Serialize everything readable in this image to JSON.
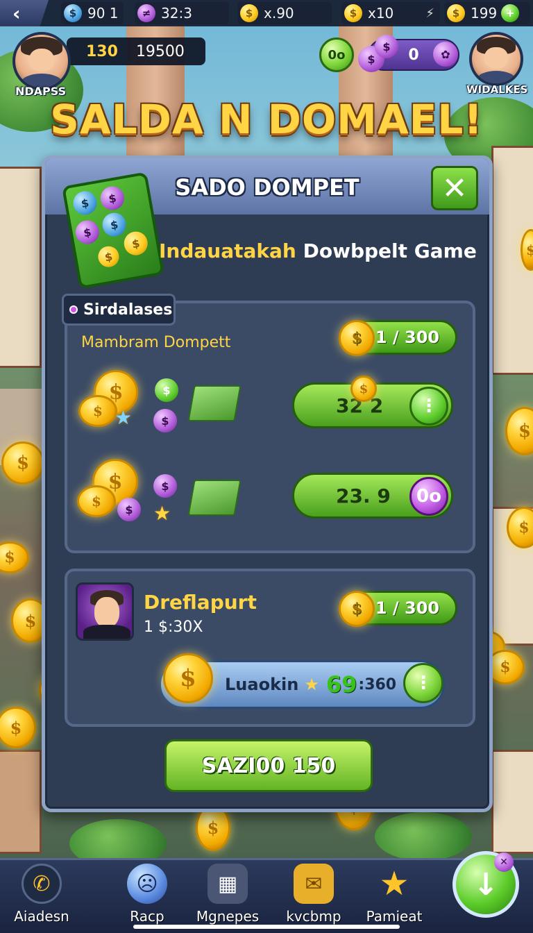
{
  "topbar": {
    "resources": [
      {
        "icon": "blue-coin-icon",
        "value": "90 1"
      },
      {
        "icon": "purple-gem-icon",
        "value": "32:3"
      },
      {
        "icon": "gold-coin-icon",
        "value": "x.90"
      },
      {
        "icon": "gold-coin-icon",
        "value": "x10"
      },
      {
        "icon": "gold-coin-icon",
        "value": "199"
      }
    ]
  },
  "player": {
    "name": "NDAPSS",
    "level": "130",
    "score": "19500",
    "friend_name": "WIDALKES",
    "counter_value": "0",
    "circle_label": "0o"
  },
  "title": "SALDA N DOMAEL!",
  "panel": {
    "title": "SADO DOMPET",
    "subtitle_highlight": "Indauatakah",
    "subtitle_rest": "Dowbpelt Game",
    "section_tag": "Sirdalases",
    "section_label": "Mambram Dompett",
    "progress_1": "1 / 300",
    "bar_1_value": "32 2",
    "bar_2_value": "23. 9",
    "bar_2_end_label": "0o",
    "reward": {
      "name": "Dreflapurt",
      "rate": "1 $:30X",
      "progress": "1 / 300",
      "bar_label": "Luaokin",
      "bar_value": "69",
      "bar_cap": ":360"
    },
    "claim_button": "SAZI00 150"
  },
  "nav": [
    {
      "icon": "phone-icon",
      "label": "Aiadesn"
    },
    {
      "icon": "face-icon",
      "label": "Racp"
    },
    {
      "icon": "grid-icon",
      "label": "Mgnepes"
    },
    {
      "icon": "mail-icon",
      "label": "kvcbmp"
    },
    {
      "icon": "star-icon",
      "label": "Pamieat"
    }
  ],
  "colors": {
    "accent_gold": "#ffd445",
    "accent_green": "#5ccc2a",
    "panel_bg": "#2e3c54"
  }
}
